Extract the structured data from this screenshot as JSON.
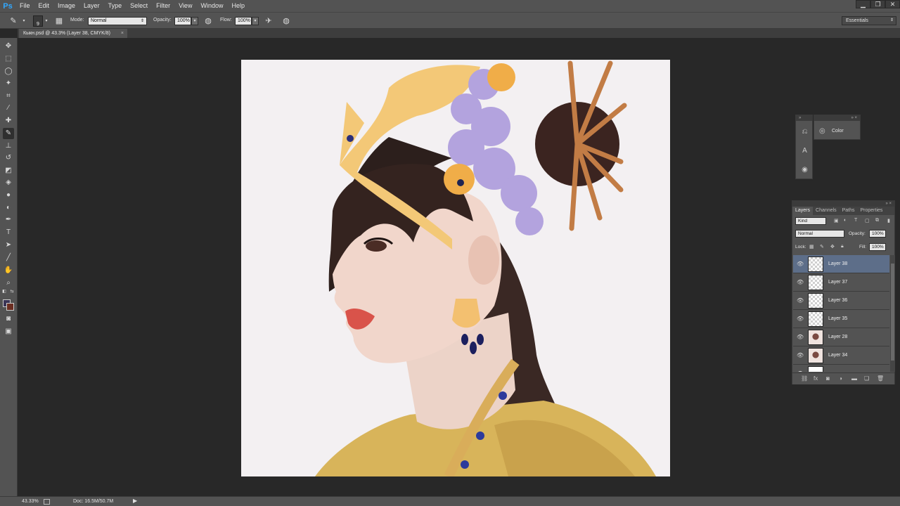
{
  "app": {
    "logo": "Ps"
  },
  "menu": [
    "File",
    "Edit",
    "Image",
    "Layer",
    "Type",
    "Select",
    "Filter",
    "View",
    "Window",
    "Help"
  ],
  "window_controls": {
    "minimize": "▁",
    "restore": "❐",
    "close": "✕"
  },
  "options_bar": {
    "brush_size": "9",
    "mode_label": "Mode:",
    "mode_value": "Normal",
    "opacity_label": "Opacity:",
    "opacity_value": "100%",
    "flow_label": "Flow:",
    "flow_value": "100%",
    "workspace": "Essentials"
  },
  "document_tab": {
    "title": "Кыкн.psd @ 43.3% (Layer 38, CMYK/8)",
    "close": "×"
  },
  "status": {
    "zoom": "43.33%",
    "doc_size": "Doc: 16.5M/50.7M",
    "arrow": "▶"
  },
  "color_panel": {
    "label": "Color"
  },
  "layers_panel": {
    "tabs": [
      "Layers",
      "Channels",
      "Paths",
      "Properties"
    ],
    "kind_label": "Kind",
    "blend_mode": "Normal",
    "opacity_label": "Opacity:",
    "opacity_value": "100%",
    "lock_label": "Lock:",
    "fill_label": "Fill:",
    "fill_value": "100%",
    "layers": [
      {
        "name": "Layer 38",
        "selected": true,
        "thumb": "transparent"
      },
      {
        "name": "Layer 37",
        "selected": false,
        "thumb": "transparent"
      },
      {
        "name": "Layer 36",
        "selected": false,
        "thumb": "transparent"
      },
      {
        "name": "Layer 35",
        "selected": false,
        "thumb": "transparent"
      },
      {
        "name": "Layer 28",
        "selected": false,
        "thumb": "image"
      },
      {
        "name": "Layer 34",
        "selected": false,
        "thumb": "image"
      },
      {
        "name": "",
        "selected": false,
        "thumb": "transparent"
      }
    ]
  },
  "colors": {
    "foreground": "#3a3456",
    "background": "#6b2e22",
    "selection": "#5d6e89",
    "canvas": "#f3f0f2"
  }
}
